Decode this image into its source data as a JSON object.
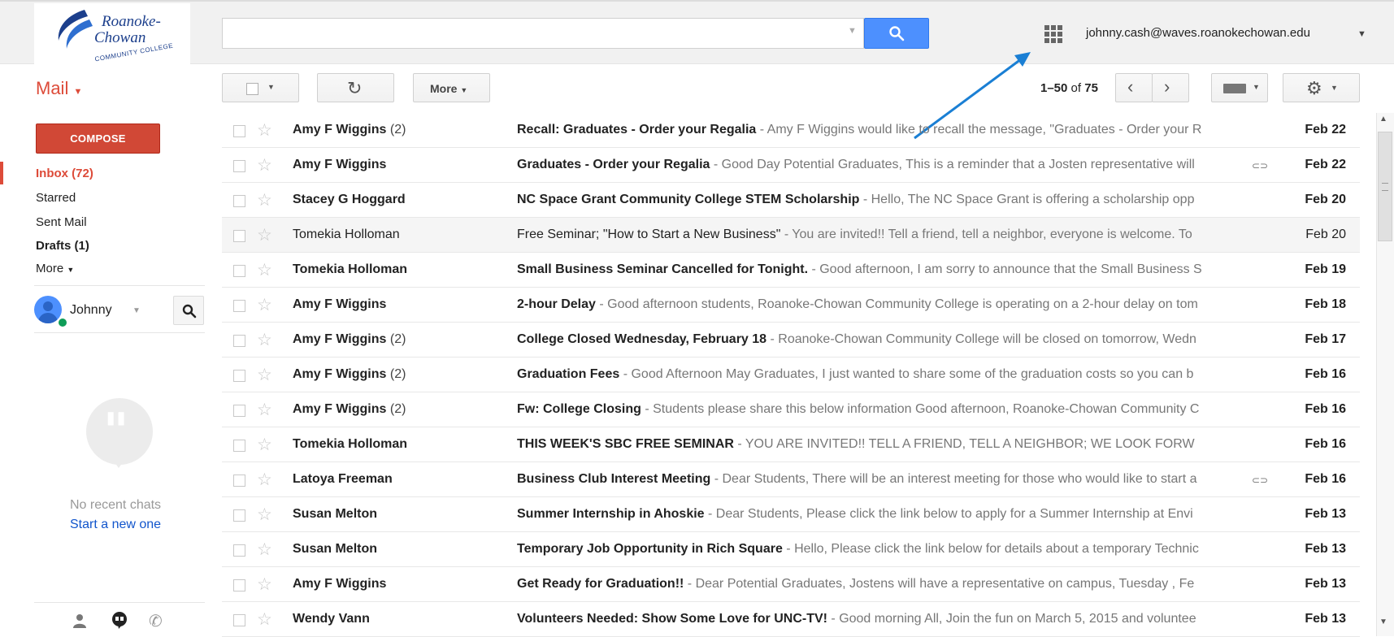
{
  "logo": {
    "line1": "Roanoke-",
    "line2": "Chowan",
    "line3": "COMMUNITY COLLEGE"
  },
  "search": {
    "value": "",
    "placeholder": ""
  },
  "account": {
    "email": "johnny.cash@waves.roanokechowan.edu"
  },
  "toolbar": {
    "mail_label": "Mail",
    "more_label": "More",
    "pager_range": "1–50",
    "pager_of": "of",
    "pager_total": "75"
  },
  "sidebar": {
    "compose_label": "COMPOSE",
    "items": [
      {
        "label": "Inbox (72)"
      },
      {
        "label": "Starred"
      },
      {
        "label": "Sent Mail"
      },
      {
        "label": "Drafts (1)"
      },
      {
        "label": "More"
      }
    ]
  },
  "hangouts": {
    "user": "Johnny",
    "no_chats": "No recent chats",
    "start_new": "Start a new one"
  },
  "messages": [
    {
      "sender": "Amy F Wiggins",
      "count": "(2)",
      "subject": "Recall: Graduates - Order your Regalia",
      "snippet": " - Amy F Wiggins would like to recall the message, \"Graduates - Order your R",
      "date": "Feb 22",
      "attachment": false,
      "unread": true
    },
    {
      "sender": "Amy F Wiggins",
      "count": "",
      "subject": "Graduates - Order your Regalia",
      "snippet": " - Good Day Potential Graduates, This is a reminder that a Josten representative will",
      "date": "Feb 22",
      "attachment": true,
      "unread": true
    },
    {
      "sender": "Stacey G Hoggard",
      "count": "",
      "subject": "NC Space Grant Community College STEM Scholarship",
      "snippet": " - Hello, The NC Space Grant is offering a scholarship opp",
      "date": "Feb 20",
      "attachment": false,
      "unread": true
    },
    {
      "sender": "Tomekia Holloman",
      "count": "",
      "subject": "Free Seminar; \"How to Start a New Business\"",
      "snippet": " - You are invited!! Tell a friend, tell a neighbor, everyone is welcome. To",
      "date": "Feb 20",
      "attachment": false,
      "unread": false
    },
    {
      "sender": "Tomekia Holloman",
      "count": "",
      "subject": "Small Business Seminar Cancelled for Tonight.",
      "snippet": " - Good afternoon, I am sorry to announce that the Small Business S",
      "date": "Feb 19",
      "attachment": false,
      "unread": true
    },
    {
      "sender": "Amy F Wiggins",
      "count": "",
      "subject": "2-hour Delay",
      "snippet": " - Good afternoon students, Roanoke-Chowan Community College is operating on a 2-hour delay on tom",
      "date": "Feb 18",
      "attachment": false,
      "unread": true
    },
    {
      "sender": "Amy F Wiggins",
      "count": "(2)",
      "subject": "College Closed Wednesday, February 18",
      "snippet": " - Roanoke-Chowan Community College will be closed on tomorrow, Wedn",
      "date": "Feb 17",
      "attachment": false,
      "unread": true
    },
    {
      "sender": "Amy F Wiggins",
      "count": "(2)",
      "subject": "Graduation Fees",
      "snippet": " - Good Afternoon May Graduates, I just wanted to share some of the graduation costs so you can b",
      "date": "Feb 16",
      "attachment": false,
      "unread": true
    },
    {
      "sender": "Amy F Wiggins",
      "count": "(2)",
      "subject": "Fw: College Closing",
      "snippet": " - Students please share this below information Good afternoon, Roanoke-Chowan Community C",
      "date": "Feb 16",
      "attachment": false,
      "unread": true
    },
    {
      "sender": "Tomekia Holloman",
      "count": "",
      "subject": "THIS WEEK'S SBC FREE SEMINAR",
      "snippet": " - YOU ARE INVITED!! TELL A FRIEND, TELL A NEIGHBOR; WE LOOK FORW",
      "date": "Feb 16",
      "attachment": false,
      "unread": true
    },
    {
      "sender": "Latoya Freeman",
      "count": "",
      "subject": "Business Club Interest Meeting",
      "snippet": " - Dear Students, There will be an interest meeting for those who would like to start a",
      "date": "Feb 16",
      "attachment": true,
      "unread": true
    },
    {
      "sender": "Susan Melton",
      "count": "",
      "subject": "Summer Internship in Ahoskie",
      "snippet": " - Dear Students, Please click the link below to apply for a Summer Internship at Envi",
      "date": "Feb 13",
      "attachment": false,
      "unread": true
    },
    {
      "sender": "Susan Melton",
      "count": "",
      "subject": "Temporary Job Opportunity in Rich Square",
      "snippet": " - Hello, Please click the link below for details about a temporary Technic",
      "date": "Feb 13",
      "attachment": false,
      "unread": true
    },
    {
      "sender": "Amy F Wiggins",
      "count": "",
      "subject": "Get Ready for Graduation!!",
      "snippet": " - Dear Potential Graduates, Jostens will have a representative on campus, Tuesday , Fe",
      "date": "Feb 13",
      "attachment": false,
      "unread": true
    },
    {
      "sender": "Wendy Vann",
      "count": "",
      "subject": "Volunteers Needed: Show Some Love for UNC-TV!",
      "snippet": " - Good morning All, Join the fun on March 5, 2015 and voluntee",
      "date": "Feb 13",
      "attachment": false,
      "unread": true
    }
  ],
  "colors": {
    "accent": "#dd4b39",
    "compose": "#d14836",
    "search_button": "#4d90fe",
    "link": "#1155cc",
    "annotation_arrow": "#1a7fd4"
  }
}
